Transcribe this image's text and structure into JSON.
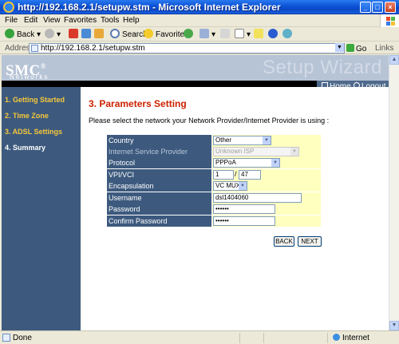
{
  "window": {
    "title": "http://192.168.2.1/setupw.stm - Microsoft Internet Explorer",
    "min": "_",
    "max": "□",
    "close": "×"
  },
  "menu": [
    "File",
    "Edit",
    "View",
    "Favorites",
    "Tools",
    "Help"
  ],
  "toolbar": {
    "back": "Back",
    "search": "Search",
    "favorites": "Favorites"
  },
  "address": {
    "label": "Address",
    "url": "http://192.168.2.1/setupw.stm",
    "go": "Go",
    "links": "Links"
  },
  "header": {
    "logo": "SMC",
    "logo_mark": "®",
    "logo_sub": "Networks",
    "banner": "Setup Wizard",
    "home": "Home",
    "logout": "Logout"
  },
  "sidebar": {
    "items": [
      {
        "label": "1. Getting Started"
      },
      {
        "label": "2. Time Zone"
      },
      {
        "label": "3. ADSL Settings"
      },
      {
        "label": "4. Summary"
      }
    ]
  },
  "main": {
    "heading": "3. Parameters Setting",
    "instruction": "Please select the network your Network Provider/Internet Provider is using :",
    "form": {
      "country": {
        "label": "Country",
        "value": "Other"
      },
      "isp": {
        "label": "Internet Service Provider",
        "value": "Unknown ISP"
      },
      "protocol": {
        "label": "Protocol",
        "value": "PPPoA"
      },
      "vpivci": {
        "label": "VPI/VCI",
        "vpi": "1",
        "separator": "/",
        "vci": "47"
      },
      "encapsulation": {
        "label": "Encapsulation",
        "value": "VC MUX"
      },
      "username": {
        "label": "Username",
        "value": "dsl1404060"
      },
      "password": {
        "label": "Password",
        "value": "••••••"
      },
      "confirm_password": {
        "label": "Confirm Password",
        "value": "••••••"
      }
    },
    "back_button": "BACK",
    "next_button": "NEXT"
  },
  "status": {
    "text": "Done",
    "zone": "Internet"
  }
}
